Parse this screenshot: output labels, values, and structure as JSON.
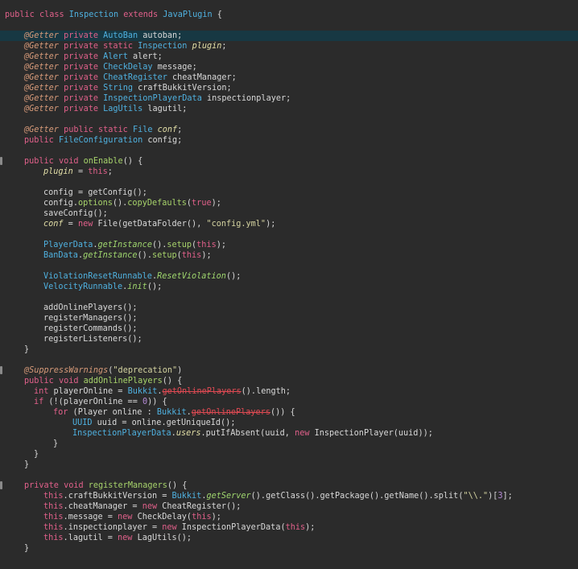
{
  "editor": {
    "lines": [
      {
        "indent": 6,
        "tokens": [
          [
            "public ",
            "kw"
          ],
          [
            "class ",
            "kw"
          ],
          [
            "Inspection ",
            "type"
          ],
          [
            "extends ",
            "kw"
          ],
          [
            "JavaPlugin ",
            "type"
          ],
          [
            "{",
            "punct"
          ]
        ]
      },
      {
        "indent": 6,
        "tokens": []
      },
      {
        "indent": 30,
        "highlight": true,
        "tokens": [
          [
            "@Getter ",
            "ann"
          ],
          [
            "private ",
            "kw"
          ],
          [
            "AutoBan ",
            "type"
          ],
          [
            "autoban",
            "id"
          ],
          [
            ";",
            "punct"
          ]
        ]
      },
      {
        "indent": 30,
        "tokens": [
          [
            "@Getter ",
            "ann"
          ],
          [
            "private ",
            "kw"
          ],
          [
            "static ",
            "kw"
          ],
          [
            "Inspection ",
            "type"
          ],
          [
            "plugin",
            "field"
          ],
          [
            ";",
            "punct"
          ]
        ]
      },
      {
        "indent": 30,
        "tokens": [
          [
            "@Getter ",
            "ann"
          ],
          [
            "private ",
            "kw"
          ],
          [
            "Alert ",
            "type"
          ],
          [
            "alert",
            "id"
          ],
          [
            ";",
            "punct"
          ]
        ]
      },
      {
        "indent": 30,
        "tokens": [
          [
            "@Getter ",
            "ann"
          ],
          [
            "private ",
            "kw"
          ],
          [
            "CheckDelay ",
            "type"
          ],
          [
            "message",
            "id"
          ],
          [
            ";",
            "punct"
          ]
        ]
      },
      {
        "indent": 30,
        "tokens": [
          [
            "@Getter ",
            "ann"
          ],
          [
            "private ",
            "kw"
          ],
          [
            "CheatRegister ",
            "type"
          ],
          [
            "cheatManager",
            "id"
          ],
          [
            ";",
            "punct"
          ]
        ]
      },
      {
        "indent": 30,
        "tokens": [
          [
            "@Getter ",
            "ann"
          ],
          [
            "private ",
            "kw"
          ],
          [
            "String ",
            "type"
          ],
          [
            "craftBukkitVersion",
            "id"
          ],
          [
            ";",
            "punct"
          ]
        ]
      },
      {
        "indent": 30,
        "tokens": [
          [
            "@Getter ",
            "ann"
          ],
          [
            "private ",
            "kw"
          ],
          [
            "InspectionPlayerData ",
            "type"
          ],
          [
            "inspectionplayer",
            "id"
          ],
          [
            ";",
            "punct"
          ]
        ]
      },
      {
        "indent": 30,
        "tokens": [
          [
            "@Getter ",
            "ann"
          ],
          [
            "private ",
            "kw"
          ],
          [
            "LagUtils ",
            "type"
          ],
          [
            "lagutil",
            "id"
          ],
          [
            ";",
            "punct"
          ]
        ]
      },
      {
        "indent": 30,
        "tokens": []
      },
      {
        "indent": 30,
        "tokens": [
          [
            "@Getter ",
            "ann"
          ],
          [
            "public ",
            "kw"
          ],
          [
            "static ",
            "kw"
          ],
          [
            "File ",
            "type"
          ],
          [
            "conf",
            "field"
          ],
          [
            ";",
            "punct"
          ]
        ]
      },
      {
        "indent": 30,
        "tokens": [
          [
            "public ",
            "kw"
          ],
          [
            "FileConfiguration ",
            "type"
          ],
          [
            "config",
            "id"
          ],
          [
            ";",
            "punct"
          ]
        ]
      },
      {
        "indent": 30,
        "tokens": []
      },
      {
        "indent": 30,
        "gutter": true,
        "tokens": [
          [
            "public ",
            "kw"
          ],
          [
            "void ",
            "kw"
          ],
          [
            "onEnable",
            "method"
          ],
          [
            "() {",
            "punct"
          ]
        ]
      },
      {
        "indent": 54,
        "tokens": [
          [
            "plugin",
            "field"
          ],
          [
            " = ",
            "punct"
          ],
          [
            "this",
            "kw"
          ],
          [
            ";",
            "punct"
          ]
        ]
      },
      {
        "indent": 54,
        "tokens": []
      },
      {
        "indent": 54,
        "tokens": [
          [
            "config",
            "id"
          ],
          [
            " = ",
            "punct"
          ],
          [
            "getConfig",
            "id"
          ],
          [
            "();",
            "punct"
          ]
        ]
      },
      {
        "indent": 54,
        "tokens": [
          [
            "config",
            "id"
          ],
          [
            ".",
            "punct"
          ],
          [
            "options",
            "method"
          ],
          [
            "().",
            "punct"
          ],
          [
            "copyDefaults",
            "method"
          ],
          [
            "(",
            "punct"
          ],
          [
            "true",
            "kw"
          ],
          [
            ");",
            "punct"
          ]
        ]
      },
      {
        "indent": 54,
        "tokens": [
          [
            "saveConfig",
            "id"
          ],
          [
            "();",
            "punct"
          ]
        ]
      },
      {
        "indent": 54,
        "tokens": [
          [
            "conf",
            "field"
          ],
          [
            " = ",
            "punct"
          ],
          [
            "new ",
            "kw"
          ],
          [
            "File",
            "id"
          ],
          [
            "(",
            "punct"
          ],
          [
            "getDataFolder",
            "id"
          ],
          [
            "(), ",
            "punct"
          ],
          [
            "\"config.yml\"",
            "str"
          ],
          [
            ");",
            "punct"
          ]
        ]
      },
      {
        "indent": 54,
        "tokens": []
      },
      {
        "indent": 54,
        "tokens": [
          [
            "PlayerData",
            "type"
          ],
          [
            ".",
            "punct"
          ],
          [
            "getInstance",
            "static"
          ],
          [
            "().",
            "punct"
          ],
          [
            "setup",
            "method"
          ],
          [
            "(",
            "punct"
          ],
          [
            "this",
            "kw"
          ],
          [
            ");",
            "punct"
          ]
        ]
      },
      {
        "indent": 54,
        "tokens": [
          [
            "BanData",
            "type"
          ],
          [
            ".",
            "punct"
          ],
          [
            "getInstance",
            "static"
          ],
          [
            "().",
            "punct"
          ],
          [
            "setup",
            "method"
          ],
          [
            "(",
            "punct"
          ],
          [
            "this",
            "kw"
          ],
          [
            ");",
            "punct"
          ]
        ]
      },
      {
        "indent": 54,
        "tokens": []
      },
      {
        "indent": 54,
        "tokens": [
          [
            "ViolationResetRunnable",
            "type"
          ],
          [
            ".",
            "punct"
          ],
          [
            "ResetViolation",
            "static"
          ],
          [
            "();",
            "punct"
          ]
        ]
      },
      {
        "indent": 54,
        "tokens": [
          [
            "VelocityRunnable",
            "type"
          ],
          [
            ".",
            "punct"
          ],
          [
            "init",
            "static"
          ],
          [
            "();",
            "punct"
          ]
        ]
      },
      {
        "indent": 54,
        "tokens": []
      },
      {
        "indent": 54,
        "tokens": [
          [
            "addOnlinePlayers",
            "id"
          ],
          [
            "();",
            "punct"
          ]
        ]
      },
      {
        "indent": 54,
        "tokens": [
          [
            "registerManagers",
            "id"
          ],
          [
            "();",
            "punct"
          ]
        ]
      },
      {
        "indent": 54,
        "tokens": [
          [
            "registerCommands",
            "id"
          ],
          [
            "();",
            "punct"
          ]
        ]
      },
      {
        "indent": 54,
        "tokens": [
          [
            "registerListeners",
            "id"
          ],
          [
            "();",
            "punct"
          ]
        ]
      },
      {
        "indent": 30,
        "tokens": [
          [
            "}",
            "punct"
          ]
        ]
      },
      {
        "indent": 30,
        "tokens": []
      },
      {
        "indent": 30,
        "gutter": true,
        "tokens": [
          [
            "@SuppressWarnings",
            "ann"
          ],
          [
            "(",
            "punct"
          ],
          [
            "\"deprecation\"",
            "str"
          ],
          [
            ")",
            "punct"
          ]
        ]
      },
      {
        "indent": 30,
        "tokens": [
          [
            "public ",
            "kw"
          ],
          [
            "void ",
            "kw"
          ],
          [
            "addOnlinePlayers",
            "method"
          ],
          [
            "() {",
            "punct"
          ]
        ]
      },
      {
        "indent": 42,
        "tokens": [
          [
            "int ",
            "kw"
          ],
          [
            "playerOnline",
            "id"
          ],
          [
            " = ",
            "punct"
          ],
          [
            "Bukkit",
            "type"
          ],
          [
            ".",
            "punct"
          ],
          [
            "getOnlinePlayers",
            "strike"
          ],
          [
            "().",
            "punct"
          ],
          [
            "length",
            "id"
          ],
          [
            ";",
            "punct"
          ]
        ]
      },
      {
        "indent": 42,
        "tokens": [
          [
            "if ",
            "kw"
          ],
          [
            "(!(",
            "punct"
          ],
          [
            "playerOnline",
            "id"
          ],
          [
            " == ",
            "punct"
          ],
          [
            "0",
            "num"
          ],
          [
            ")) {",
            "punct"
          ]
        ]
      },
      {
        "indent": 66,
        "tokens": [
          [
            "for ",
            "kw"
          ],
          [
            "(",
            "punct"
          ],
          [
            "Player ",
            "id"
          ],
          [
            "online",
            "id"
          ],
          [
            " : ",
            "punct"
          ],
          [
            "Bukkit",
            "type"
          ],
          [
            ".",
            "punct"
          ],
          [
            "getOnlinePlayers",
            "strike"
          ],
          [
            "()) {",
            "punct"
          ]
        ]
      },
      {
        "indent": 90,
        "tokens": [
          [
            "UUID ",
            "type"
          ],
          [
            "uuid",
            "id"
          ],
          [
            " = ",
            "punct"
          ],
          [
            "online",
            "id"
          ],
          [
            ".",
            "punct"
          ],
          [
            "getUniqueId",
            "id"
          ],
          [
            "();",
            "punct"
          ]
        ]
      },
      {
        "indent": 90,
        "tokens": [
          [
            "InspectionPlayerData",
            "type"
          ],
          [
            ".",
            "punct"
          ],
          [
            "users",
            "field"
          ],
          [
            ".",
            "punct"
          ],
          [
            "putIfAbsent",
            "id"
          ],
          [
            "(",
            "punct"
          ],
          [
            "uuid",
            "id"
          ],
          [
            ", ",
            "punct"
          ],
          [
            "new ",
            "kw"
          ],
          [
            "InspectionPlayer",
            "id"
          ],
          [
            "(",
            "punct"
          ],
          [
            "uuid",
            "id"
          ],
          [
            "));",
            "punct"
          ]
        ]
      },
      {
        "indent": 66,
        "tokens": [
          [
            "}",
            "punct"
          ]
        ]
      },
      {
        "indent": 42,
        "tokens": [
          [
            "}",
            "punct"
          ]
        ]
      },
      {
        "indent": 30,
        "tokens": [
          [
            "}",
            "punct"
          ]
        ]
      },
      {
        "indent": 30,
        "tokens": []
      },
      {
        "indent": 30,
        "gutter": true,
        "tokens": [
          [
            "private ",
            "kw"
          ],
          [
            "void ",
            "kw"
          ],
          [
            "registerManagers",
            "method"
          ],
          [
            "() {",
            "punct"
          ]
        ]
      },
      {
        "indent": 54,
        "tokens": [
          [
            "this",
            "kw"
          ],
          [
            ".",
            "punct"
          ],
          [
            "craftBukkitVersion",
            "id"
          ],
          [
            " = ",
            "punct"
          ],
          [
            "Bukkit",
            "type"
          ],
          [
            ".",
            "punct"
          ],
          [
            "getServer",
            "static"
          ],
          [
            "().",
            "punct"
          ],
          [
            "getClass",
            "id"
          ],
          [
            "().",
            "punct"
          ],
          [
            "getPackage",
            "id"
          ],
          [
            "().",
            "punct"
          ],
          [
            "getName",
            "id"
          ],
          [
            "().",
            "punct"
          ],
          [
            "split",
            "id"
          ],
          [
            "(",
            "punct"
          ],
          [
            "\"\\\\.\"",
            "str"
          ],
          [
            ")[",
            "punct"
          ],
          [
            "3",
            "num"
          ],
          [
            "];",
            "punct"
          ]
        ]
      },
      {
        "indent": 54,
        "tokens": [
          [
            "this",
            "kw"
          ],
          [
            ".",
            "punct"
          ],
          [
            "cheatManager",
            "id"
          ],
          [
            " = ",
            "punct"
          ],
          [
            "new ",
            "kw"
          ],
          [
            "CheatRegister",
            "id"
          ],
          [
            "();",
            "punct"
          ]
        ]
      },
      {
        "indent": 54,
        "tokens": [
          [
            "this",
            "kw"
          ],
          [
            ".",
            "punct"
          ],
          [
            "message",
            "id"
          ],
          [
            " = ",
            "punct"
          ],
          [
            "new ",
            "kw"
          ],
          [
            "CheckDelay",
            "id"
          ],
          [
            "(",
            "punct"
          ],
          [
            "this",
            "kw"
          ],
          [
            ");",
            "punct"
          ]
        ]
      },
      {
        "indent": 54,
        "tokens": [
          [
            "this",
            "kw"
          ],
          [
            ".",
            "punct"
          ],
          [
            "inspectionplayer",
            "id"
          ],
          [
            " = ",
            "punct"
          ],
          [
            "new ",
            "kw"
          ],
          [
            "InspectionPlayerData",
            "id"
          ],
          [
            "(",
            "punct"
          ],
          [
            "this",
            "kw"
          ],
          [
            ");",
            "punct"
          ]
        ]
      },
      {
        "indent": 54,
        "tokens": [
          [
            "this",
            "kw"
          ],
          [
            ".",
            "punct"
          ],
          [
            "lagutil",
            "id"
          ],
          [
            " = ",
            "punct"
          ],
          [
            "new ",
            "kw"
          ],
          [
            "LagUtils",
            "id"
          ],
          [
            "();",
            "punct"
          ]
        ]
      },
      {
        "indent": 30,
        "tokens": [
          [
            "}",
            "punct"
          ]
        ]
      }
    ]
  }
}
